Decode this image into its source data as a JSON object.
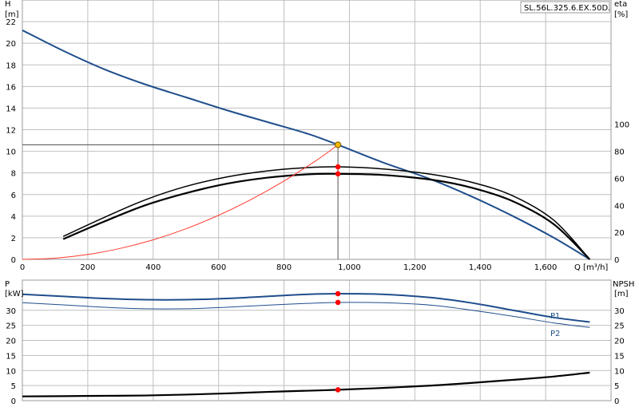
{
  "model_tag": "SL.56L.325.6.EX.50D.",
  "chart_data": [
    {
      "type": "line",
      "panel": "top",
      "xlabel": "Q [m³/h]",
      "ylabel_left_name": "H",
      "ylabel_left_unit": "[m]",
      "ylabel_right_name": "eta",
      "ylabel_right_unit": "[%]",
      "xlim": [
        0,
        1800
      ],
      "ylim_left": [
        0,
        24
      ],
      "ylim_right": [
        0,
        192
      ],
      "x_ticks": [
        0,
        200,
        400,
        600,
        800,
        1000,
        1200,
        1400,
        1600
      ],
      "x_tick_labels": [
        "0",
        "200",
        "400",
        "600",
        "800",
        "1,000",
        "1,200",
        "1,400",
        "1,600"
      ],
      "y_left_ticks": [
        0,
        2,
        4,
        6,
        8,
        10,
        12,
        14,
        16,
        18,
        20,
        22
      ],
      "y_left_tick_labels": [
        "0",
        "2",
        "4",
        "6",
        "8",
        "10",
        "12",
        "14",
        "16",
        "18",
        "20",
        "22"
      ],
      "y_right_ticks": [
        0,
        20,
        40,
        60,
        80,
        100
      ],
      "y_right_tick_labels": [
        "0",
        "20",
        "40",
        "60",
        "80",
        "100"
      ],
      "grid": true,
      "series": [
        {
          "key": "head",
          "axis": "left",
          "color": "#1f4e8c",
          "width": 2,
          "points": [
            [
              0,
              21.2
            ],
            [
              125,
              19.3
            ],
            [
              250,
              17.6
            ],
            [
              375,
              16.2
            ],
            [
              500,
              15.0
            ],
            [
              625,
              13.8
            ],
            [
              750,
              12.7
            ],
            [
              875,
              11.6
            ],
            [
              965,
              10.6
            ],
            [
              1100,
              9.0
            ],
            [
              1250,
              7.4
            ],
            [
              1375,
              5.8
            ],
            [
              1500,
              4.0
            ],
            [
              1625,
              2.0
            ],
            [
              1735,
              0.0
            ]
          ]
        },
        {
          "key": "eta_pump",
          "axis": "right",
          "color": "#000000",
          "width": 1.5,
          "points": [
            [
              125,
              17
            ],
            [
              250,
              31
            ],
            [
              375,
              44
            ],
            [
              500,
              54
            ],
            [
              625,
              61
            ],
            [
              750,
              65.5
            ],
            [
              875,
              68
            ],
            [
              965,
              68.5
            ],
            [
              1100,
              67
            ],
            [
              1250,
              63
            ],
            [
              1375,
              57
            ],
            [
              1500,
              47
            ],
            [
              1625,
              29
            ],
            [
              1735,
              0
            ]
          ]
        },
        {
          "key": "eta_total",
          "axis": "right",
          "color": "#000000",
          "width": 2.2,
          "points": [
            [
              125,
              15
            ],
            [
              250,
              28
            ],
            [
              375,
              40
            ],
            [
              500,
              49
            ],
            [
              625,
              56
            ],
            [
              750,
              60.5
            ],
            [
              875,
              63
            ],
            [
              965,
              63.3
            ],
            [
              1100,
              62.5
            ],
            [
              1250,
              59
            ],
            [
              1375,
              53
            ],
            [
              1500,
              43
            ],
            [
              1625,
              26
            ],
            [
              1735,
              0
            ]
          ]
        },
        {
          "key": "system",
          "axis": "left",
          "color": "#ff3b30",
          "width": 1,
          "points": [
            [
              0,
              0
            ],
            [
              100,
              0.11
            ],
            [
              200,
              0.45
            ],
            [
              300,
              1.02
            ],
            [
              400,
              1.81
            ],
            [
              500,
              2.83
            ],
            [
              600,
              4.08
            ],
            [
              700,
              5.55
            ],
            [
              800,
              7.25
            ],
            [
              900,
              9.18
            ],
            [
              965,
              10.6
            ]
          ]
        }
      ],
      "duty_point": {
        "q": 965,
        "h": 10.6,
        "eta_pump": 68.5,
        "eta_total": 63.3
      },
      "duty_marker_colors": {
        "duty": "#f5b800",
        "markers": "#ff0000"
      }
    },
    {
      "type": "line",
      "panel": "bottom",
      "ylabel_left_name": "P",
      "ylabel_left_unit": "[kW]",
      "ylabel_right_name": "NPSH",
      "ylabel_right_unit": "[m]",
      "xlim": [
        0,
        1800
      ],
      "ylim_left": [
        0,
        40
      ],
      "ylim_right": [
        0,
        40
      ],
      "y_left_ticks": [
        0,
        5,
        10,
        15,
        20,
        25,
        30
      ],
      "y_left_tick_labels": [
        "0",
        "5",
        "10",
        "15",
        "20",
        "25",
        "30"
      ],
      "y_right_ticks": [
        0,
        5,
        10,
        15,
        20,
        25,
        30
      ],
      "y_right_tick_labels": [
        "0",
        "5",
        "10",
        "15",
        "20",
        "25",
        "30"
      ],
      "grid": true,
      "series": [
        {
          "key": "P1",
          "name": "P1",
          "axis": "left",
          "color": "#1f4e8c",
          "width": 2,
          "points": [
            [
              0,
              35.3
            ],
            [
              125,
              34.6
            ],
            [
              250,
              33.9
            ],
            [
              375,
              33.5
            ],
            [
              500,
              33.5
            ],
            [
              625,
              33.9
            ],
            [
              750,
              34.6
            ],
            [
              875,
              35.3
            ],
            [
              965,
              35.5
            ],
            [
              1100,
              35.3
            ],
            [
              1250,
              34.2
            ],
            [
              1375,
              32.4
            ],
            [
              1500,
              30.0
            ],
            [
              1625,
              27.6
            ],
            [
              1735,
              26.1
            ]
          ]
        },
        {
          "key": "P2",
          "name": "P2",
          "axis": "left",
          "color": "#1f4e8c",
          "width": 1,
          "points": [
            [
              0,
              32.5
            ],
            [
              125,
              31.8
            ],
            [
              250,
              31.0
            ],
            [
              375,
              30.5
            ],
            [
              500,
              30.5
            ],
            [
              625,
              31.0
            ],
            [
              750,
              31.7
            ],
            [
              875,
              32.3
            ],
            [
              965,
              32.6
            ],
            [
              1100,
              32.5
            ],
            [
              1250,
              31.7
            ],
            [
              1375,
              30.0
            ],
            [
              1500,
              28.0
            ],
            [
              1625,
              25.8
            ],
            [
              1735,
              24.3
            ]
          ]
        },
        {
          "key": "NPSH",
          "axis": "right",
          "color": "#000000",
          "width": 2.2,
          "points": [
            [
              0,
              1.4
            ],
            [
              125,
              1.5
            ],
            [
              250,
              1.6
            ],
            [
              375,
              1.7
            ],
            [
              500,
              2.0
            ],
            [
              625,
              2.4
            ],
            [
              750,
              2.9
            ],
            [
              875,
              3.3
            ],
            [
              965,
              3.6
            ],
            [
              1100,
              4.2
            ],
            [
              1250,
              5.0
            ],
            [
              1375,
              5.9
            ],
            [
              1500,
              6.9
            ],
            [
              1625,
              8.0
            ],
            [
              1735,
              9.3
            ]
          ]
        }
      ],
      "duty_markers": [
        35.5,
        32.6,
        3.6
      ]
    }
  ]
}
